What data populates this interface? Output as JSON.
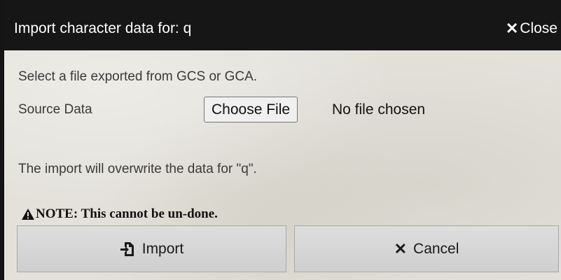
{
  "dialog": {
    "title": "Import character data for: q",
    "close_label": "Close",
    "close_icon": "x-icon"
  },
  "body": {
    "hint": "Select a file exported from GCS or GCA.",
    "source_label": "Source Data",
    "choose_file_label": "Choose File",
    "no_file_text": "No file chosen",
    "overwrite_text": "The import will overwrite the data for \"q\".",
    "note_text": "NOTE: This cannot be un-done.",
    "note_icon": "warning-icon"
  },
  "actions": {
    "import_label": "Import",
    "import_icon": "file-import-icon",
    "cancel_label": "Cancel",
    "cancel_icon": "x-icon"
  },
  "colors": {
    "titlebar": "#161616",
    "background": "#e3e1da",
    "button": "#d6d6d6"
  }
}
